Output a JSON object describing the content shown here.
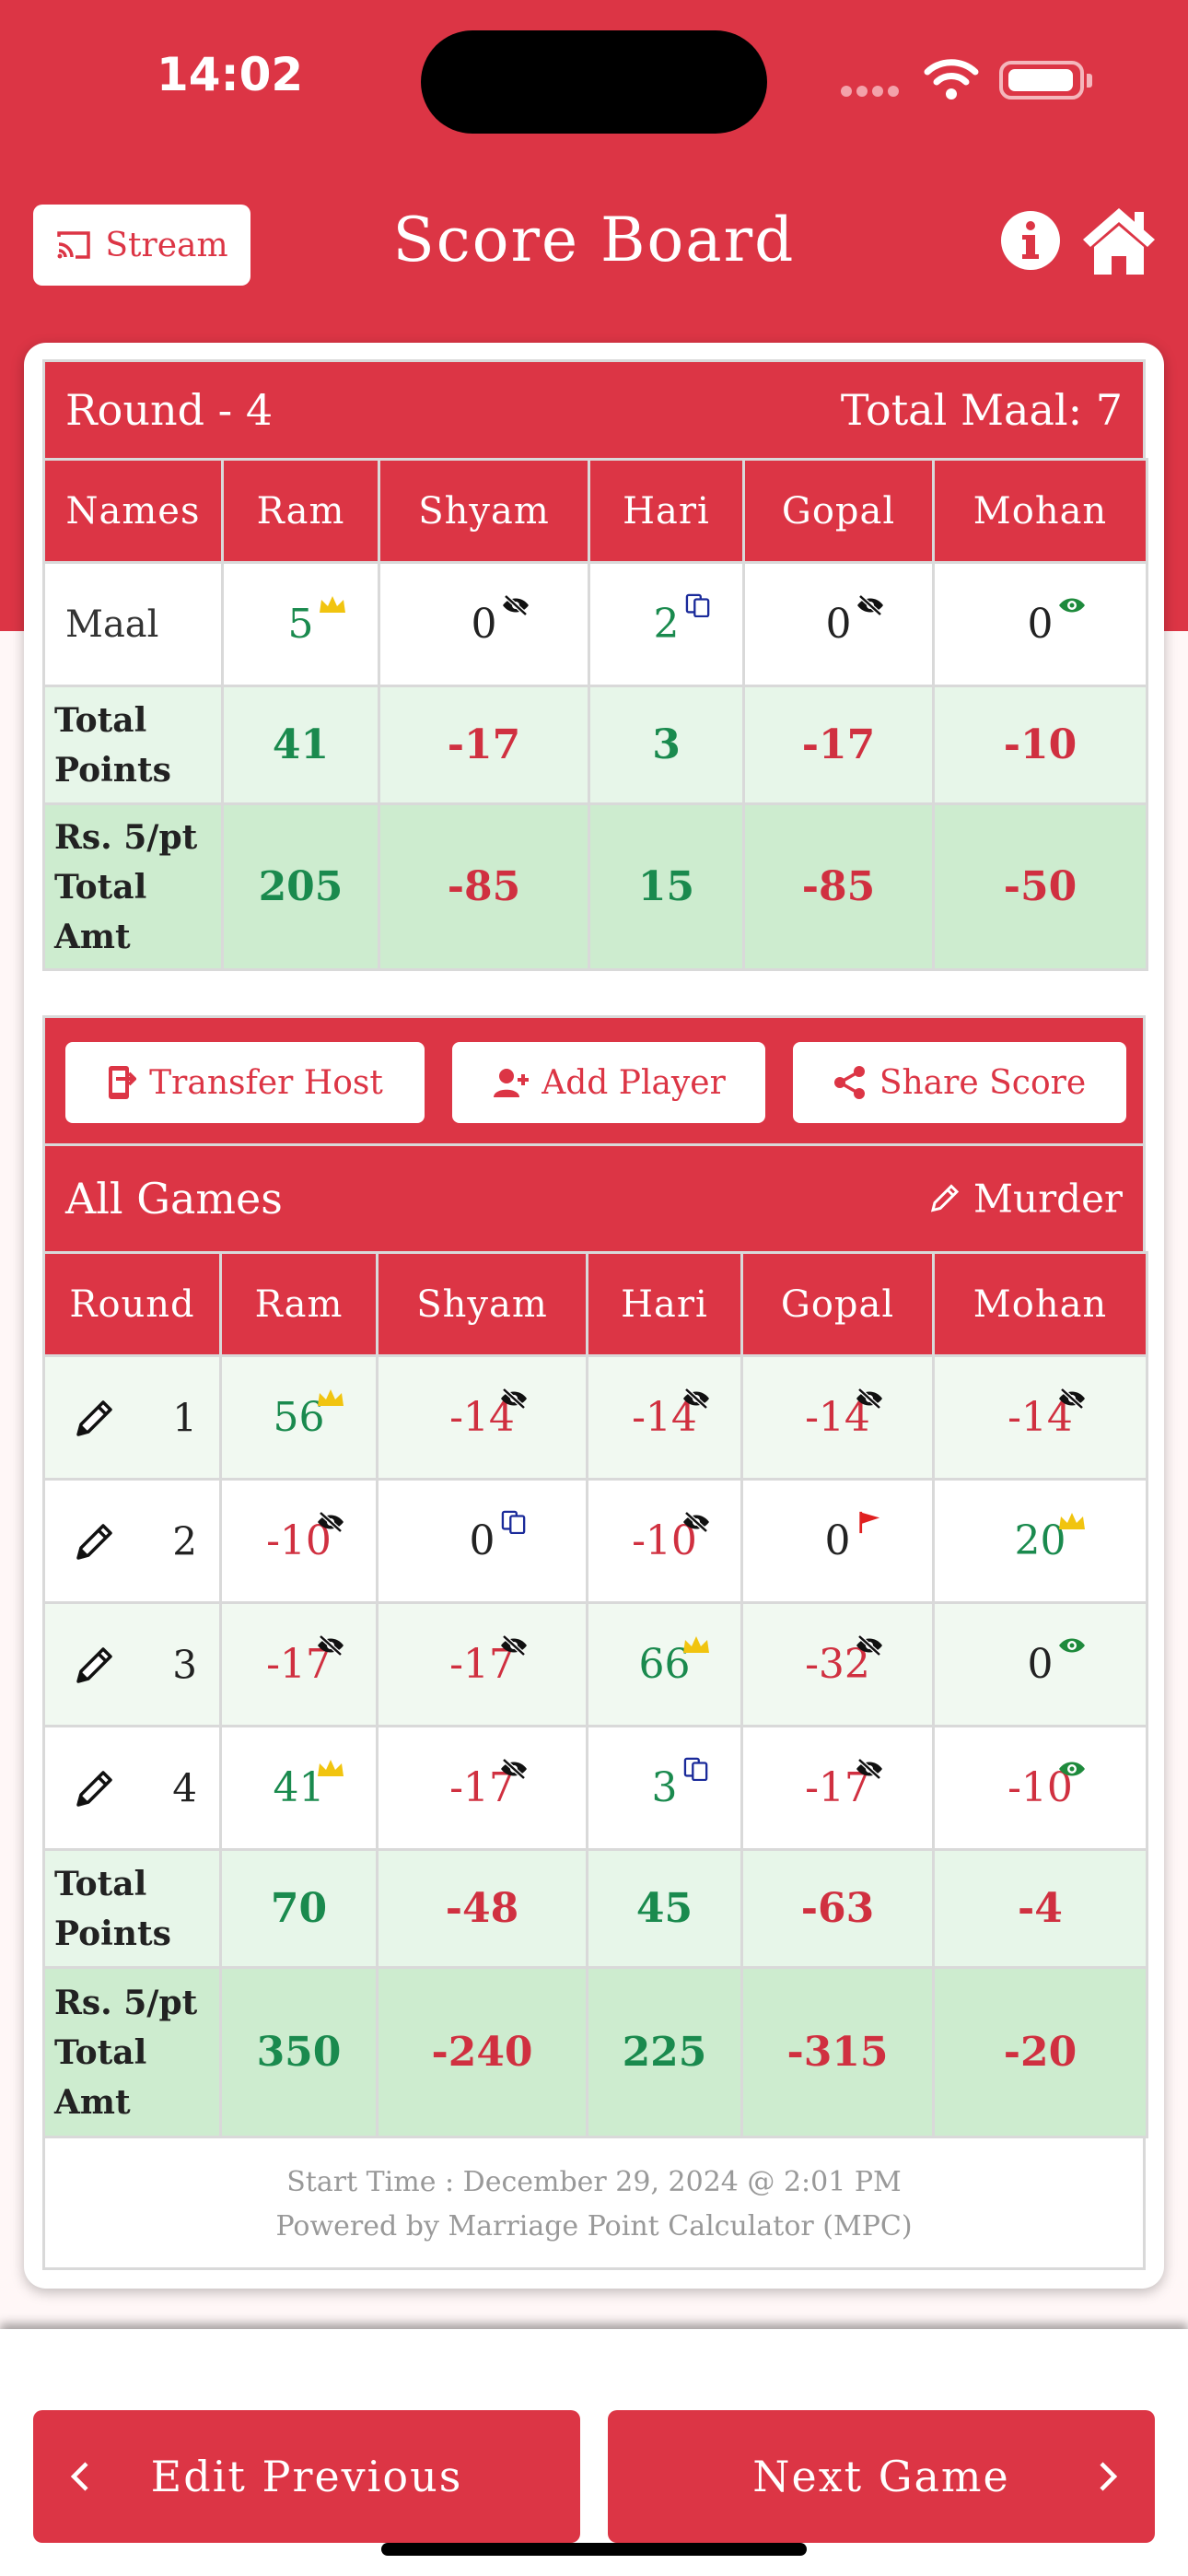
{
  "status": {
    "time": "14:02"
  },
  "header": {
    "title": "Score Board",
    "stream_label": "Stream"
  },
  "players": [
    "Ram",
    "Shyam",
    "Hari",
    "Gopal",
    "Mohan"
  ],
  "round_summary": {
    "round_label": "Round - 4",
    "total_maal_label": "Total Maal: 7",
    "names_header": "Names",
    "maal_label": "Maal",
    "maal": [
      {
        "value": "5",
        "tone": "pos",
        "badge": "crown"
      },
      {
        "value": "0",
        "tone": "zero",
        "badge": "eye-off"
      },
      {
        "value": "2",
        "tone": "pos",
        "badge": "cards"
      },
      {
        "value": "0",
        "tone": "zero",
        "badge": "eye-off"
      },
      {
        "value": "0",
        "tone": "zero",
        "badge": "eye"
      }
    ],
    "total_points_label_1": "Total",
    "total_points_label_2": "Points",
    "total_points": [
      "41",
      "-17",
      "3",
      "-17",
      "-10"
    ],
    "amt_label_1": "Rs. 5/pt",
    "amt_label_2": "Total",
    "amt_label_3": "Amt",
    "total_amt": [
      "205",
      "-85",
      "15",
      "-85",
      "-50"
    ]
  },
  "actions": {
    "transfer_host": "Transfer Host",
    "add_player": "Add Player",
    "share_score": "Share Score"
  },
  "all_games": {
    "title": "All Games",
    "murder_label": "Murder",
    "round_header": "Round",
    "rounds": [
      {
        "num": "1",
        "cells": [
          {
            "value": "56",
            "tone": "pos",
            "badge": "crown"
          },
          {
            "value": "-14",
            "tone": "neg",
            "badge": "eye-off"
          },
          {
            "value": "-14",
            "tone": "neg",
            "badge": "eye-off"
          },
          {
            "value": "-14",
            "tone": "neg",
            "badge": "eye-off"
          },
          {
            "value": "-14",
            "tone": "neg",
            "badge": "eye-off"
          }
        ]
      },
      {
        "num": "2",
        "cells": [
          {
            "value": "-10",
            "tone": "neg",
            "badge": "eye-off"
          },
          {
            "value": "0",
            "tone": "zero",
            "badge": "cards"
          },
          {
            "value": "-10",
            "tone": "neg",
            "badge": "eye-off"
          },
          {
            "value": "0",
            "tone": "zero",
            "badge": "flag"
          },
          {
            "value": "20",
            "tone": "pos",
            "badge": "crown"
          }
        ]
      },
      {
        "num": "3",
        "cells": [
          {
            "value": "-17",
            "tone": "neg",
            "badge": "eye-off"
          },
          {
            "value": "-17",
            "tone": "neg",
            "badge": "eye-off"
          },
          {
            "value": "66",
            "tone": "pos",
            "badge": "crown"
          },
          {
            "value": "-32",
            "tone": "neg",
            "badge": "eye-off"
          },
          {
            "value": "0",
            "tone": "zero",
            "badge": "eye"
          }
        ]
      },
      {
        "num": "4",
        "cells": [
          {
            "value": "41",
            "tone": "pos",
            "badge": "crown"
          },
          {
            "value": "-17",
            "tone": "neg",
            "badge": "eye-off"
          },
          {
            "value": "3",
            "tone": "pos",
            "badge": "cards"
          },
          {
            "value": "-17",
            "tone": "neg",
            "badge": "eye-off"
          },
          {
            "value": "-10",
            "tone": "neg",
            "badge": "eye"
          }
        ]
      }
    ],
    "total_points": [
      "70",
      "-48",
      "45",
      "-63",
      "-4"
    ],
    "total_amt": [
      "350",
      "-240",
      "225",
      "-315",
      "-20"
    ]
  },
  "footer": {
    "start_time": "Start Time : December 29, 2024 @ 2:01 PM",
    "powered_by": "Powered by Marriage Point Calculator (MPC)"
  },
  "nav": {
    "edit_previous": "Edit Previous",
    "next_game": "Next Game"
  },
  "colors": {
    "brand": "#dc3545",
    "positive": "#1a8a4e",
    "negative": "#d03040"
  }
}
